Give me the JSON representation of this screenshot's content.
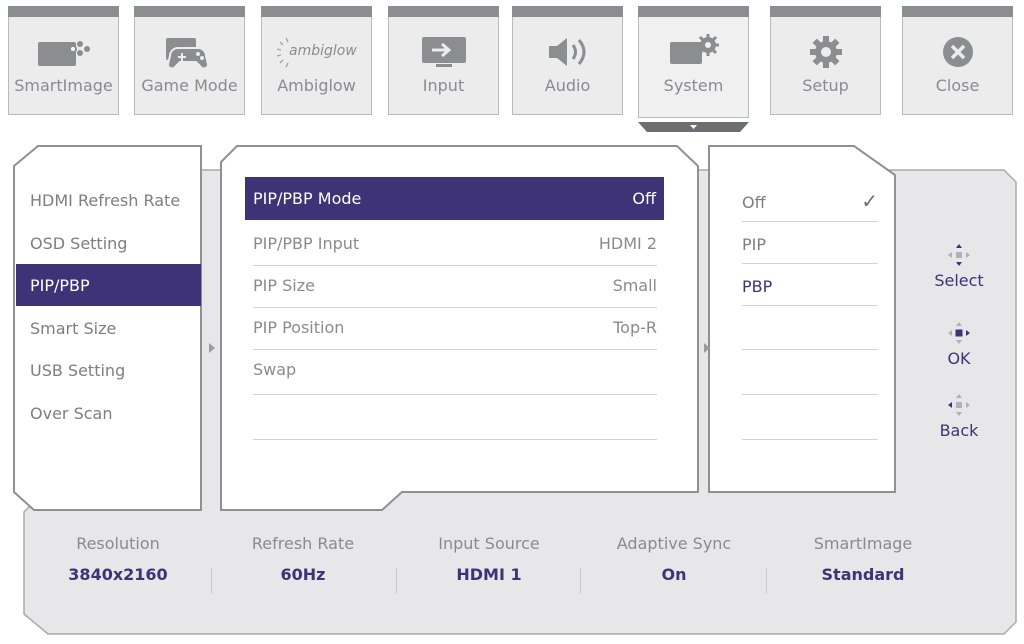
{
  "tabs": [
    {
      "label": "SmartImage",
      "icon": "smartimage-icon"
    },
    {
      "label": "Game Mode",
      "icon": "gamepad-icon"
    },
    {
      "label": "Ambiglow",
      "icon": "ambiglow-icon",
      "logo_text": "ambiglow"
    },
    {
      "label": "Input",
      "icon": "input-icon"
    },
    {
      "label": "Audio",
      "icon": "audio-icon"
    },
    {
      "label": "System",
      "icon": "system-icon",
      "selected": true
    },
    {
      "label": "Setup",
      "icon": "gear-icon"
    },
    {
      "label": "Close",
      "icon": "close-icon"
    }
  ],
  "left_menu": {
    "items": [
      "HDMI Refresh Rate",
      "OSD Setting",
      "PIP/PBP",
      "Smart Size",
      "USB Setting",
      "Over Scan"
    ],
    "selected": "PIP/PBP"
  },
  "middle_menu": {
    "rows": [
      {
        "label": "PIP/PBP Mode",
        "value": "Off"
      },
      {
        "label": "PIP/PBP Input",
        "value": "HDMI 2"
      },
      {
        "label": "PIP Size",
        "value": "Small"
      },
      {
        "label": "PIP Position",
        "value": "Top-R"
      },
      {
        "label": "Swap",
        "value": ""
      }
    ],
    "selected": "PIP/PBP Mode"
  },
  "options": {
    "items": [
      "Off",
      "PIP",
      "PBP"
    ],
    "checked": "Off",
    "check_mark": "✓"
  },
  "nav_hints": [
    {
      "label": "Select",
      "icon": "dpad-updown-icon"
    },
    {
      "label": "OK",
      "icon": "dpad-center-icon"
    },
    {
      "label": "Back",
      "icon": "dpad-left-icon"
    }
  ],
  "status": [
    {
      "label": "Resolution",
      "value": "3840x2160"
    },
    {
      "label": "Refresh Rate",
      "value": "60Hz"
    },
    {
      "label": "Input Source",
      "value": "HDMI 1"
    },
    {
      "label": "Adaptive Sync",
      "value": "On"
    },
    {
      "label": "SmartImage",
      "value": "Standard"
    }
  ],
  "colors": {
    "accent": "#3e3377",
    "panel_bg": "#ececed",
    "text_gray": "#8a8b8e",
    "tab_bar": "#8c8d90"
  }
}
